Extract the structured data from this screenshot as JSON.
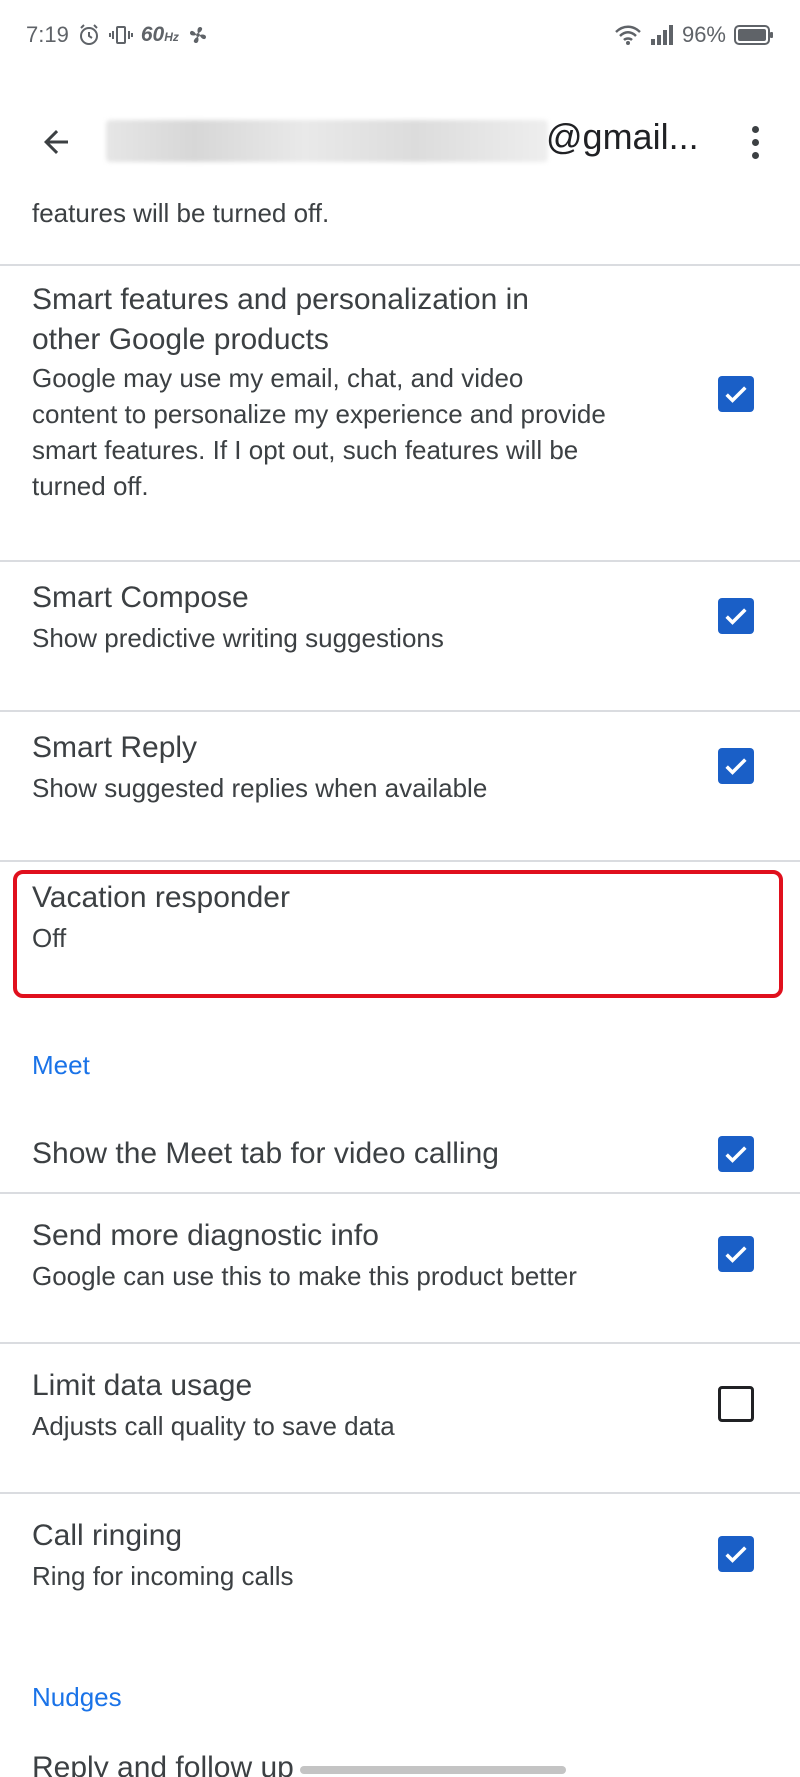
{
  "status_bar": {
    "time": "7:19",
    "refresh_rate": "60",
    "refresh_unit": "Hz",
    "battery": "96%"
  },
  "app_bar": {
    "email_suffix": "@gmail..."
  },
  "partial_text": "features will be turned off.",
  "settings": [
    {
      "title_lines": [
        "Smart features and personalization in",
        "other Google products"
      ],
      "subtitle_lines": [
        "Google may use my email, chat, and video",
        "content to personalize my experience and provide",
        "smart features. If I opt out, such features will be",
        "turned off."
      ],
      "checked": true
    },
    {
      "title": "Smart Compose",
      "subtitle": "Show predictive writing suggestions",
      "checked": true
    },
    {
      "title": "Smart Reply",
      "subtitle": "Show suggested replies when available",
      "checked": true
    },
    {
      "title": "Vacation responder",
      "subtitle": "Off"
    }
  ],
  "meet_section": {
    "header": "Meet",
    "items": [
      {
        "title": "Show the Meet tab for video calling",
        "checked": true
      },
      {
        "title": "Send more diagnostic info",
        "subtitle": "Google can use this to make this product better",
        "checked": true
      },
      {
        "title": "Limit data usage",
        "subtitle": "Adjusts call quality to save data",
        "checked": false
      },
      {
        "title": "Call ringing",
        "subtitle": "Ring for incoming calls",
        "checked": true
      }
    ]
  },
  "nudges_section": {
    "header": "Nudges",
    "partial_item": "Reply and follow up"
  },
  "colors": {
    "accent": "#1a73e8",
    "checkbox": "#1a5fc7",
    "highlight": "#e0101d",
    "divider": "#dadce0"
  }
}
